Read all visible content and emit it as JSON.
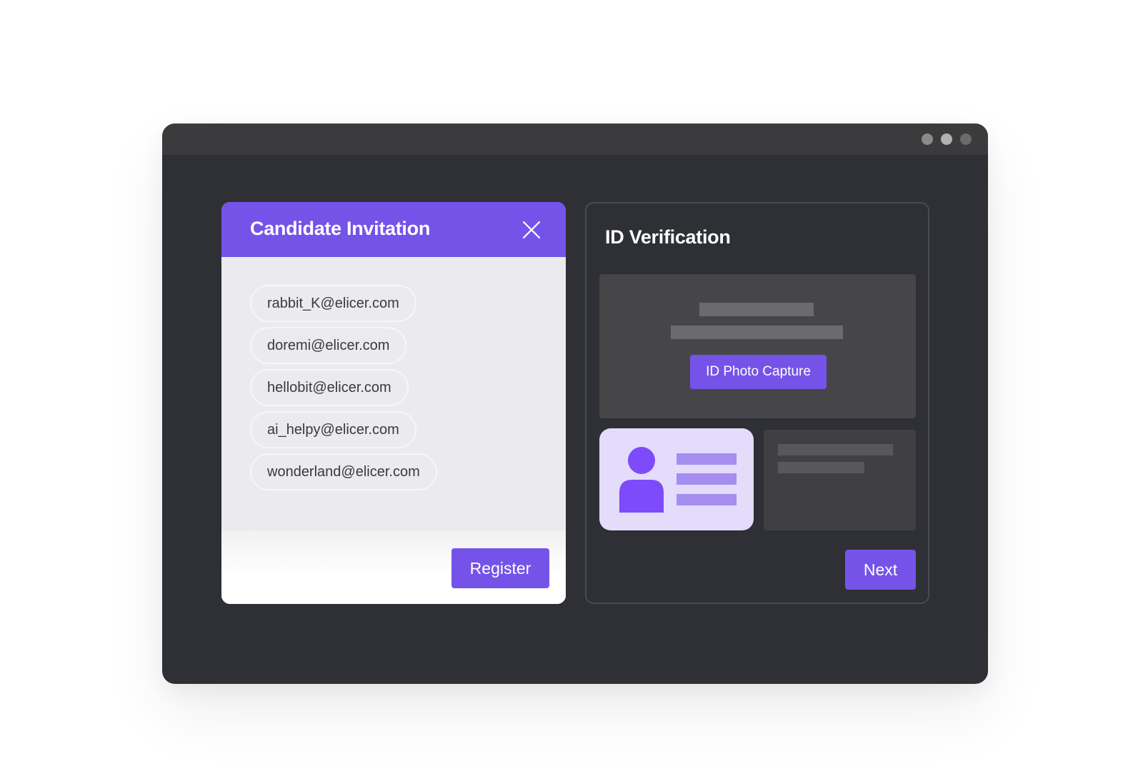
{
  "window": {
    "controls": [
      {
        "name": "window-dot-1",
        "color": "#8f8889"
      },
      {
        "name": "window-dot-2",
        "color": "#b3b0ad"
      },
      {
        "name": "window-dot-3",
        "color": "#6a6a6b"
      }
    ]
  },
  "invitation": {
    "title": "Candidate Invitation",
    "close_icon": "close-icon",
    "emails": [
      "rabbit_K@elicer.com",
      "doremi@elicer.com",
      "hellobit@elicer.com",
      "ai_helpy@elicer.com",
      "wonderland@elicer.com"
    ],
    "register_label": "Register"
  },
  "verification": {
    "title": "ID Verification",
    "capture_label": "ID Photo Capture",
    "id_card_icon": "id-card-person-icon",
    "next_label": "Next"
  },
  "colors": {
    "accent": "#7553e8",
    "window_bg": "#2e3035",
    "titlebar_bg": "#3b3b3d",
    "id_card_bg": "#e3dcfb"
  }
}
